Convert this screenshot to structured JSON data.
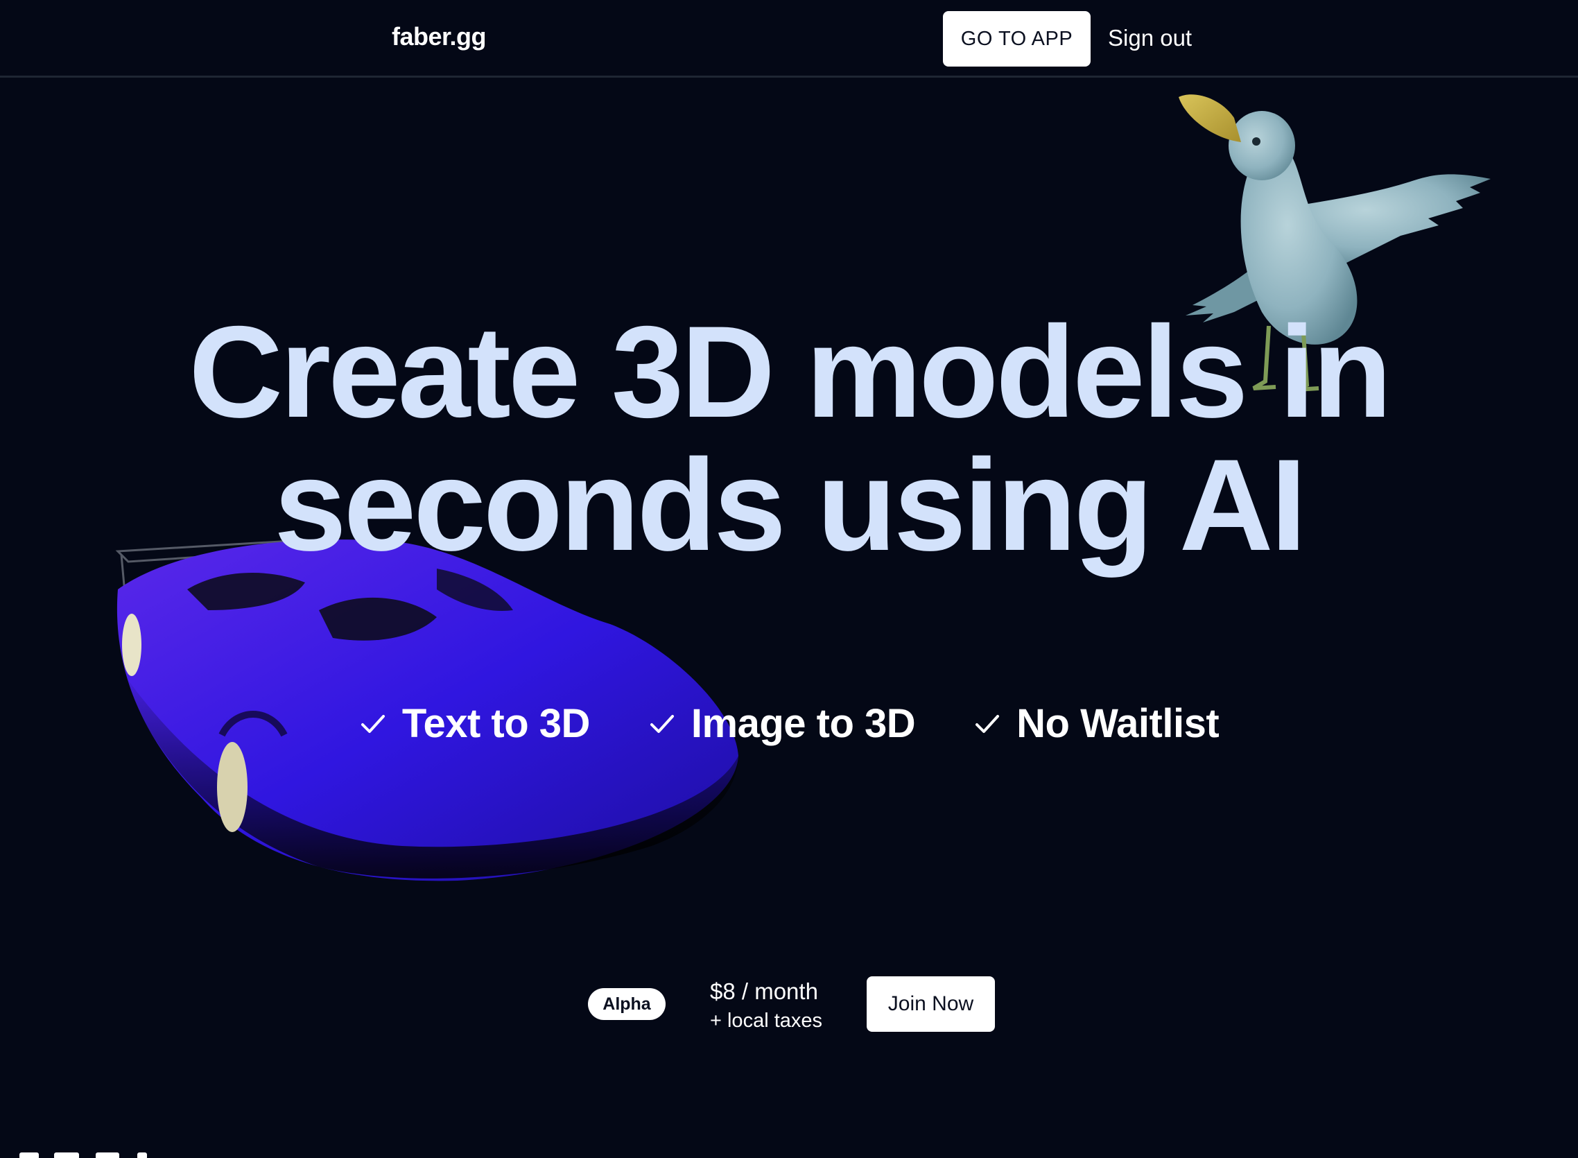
{
  "header": {
    "logo": "faber.gg",
    "go_to_app_label": "GO TO APP",
    "sign_out_label": "Sign out"
  },
  "hero": {
    "title_line1": "Create 3D models in",
    "title_line2": "seconds using AI"
  },
  "features": [
    {
      "label": "Text to 3D",
      "icon": "check-icon"
    },
    {
      "label": "Image to 3D",
      "icon": "check-icon"
    },
    {
      "label": "No Waitlist",
      "icon": "check-icon"
    }
  ],
  "pricing": {
    "badge": "Alpha",
    "price": "$8 / month",
    "taxes": "+ local taxes",
    "join_label": "Join Now"
  },
  "colors": {
    "background": "#040816",
    "hero_text": "#d3e2fb",
    "button_bg": "#ffffff",
    "car_body": "#3a17e6",
    "bird_body": "#8fb3bf",
    "bird_beak": "#c9b14a"
  }
}
